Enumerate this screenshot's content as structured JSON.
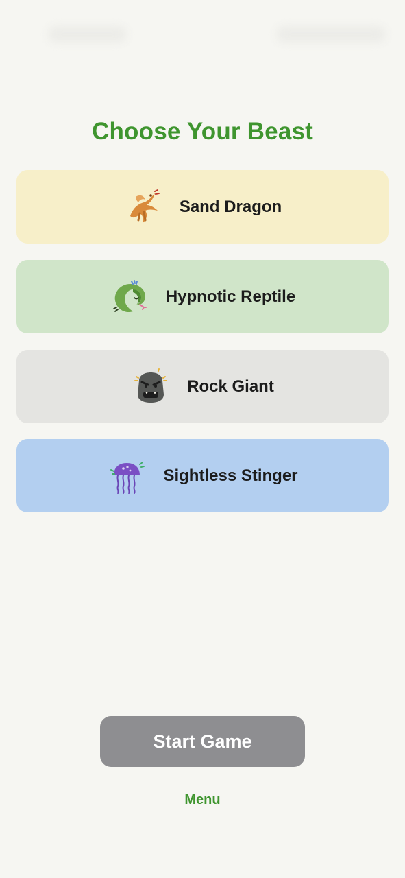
{
  "header": {
    "title": "Choose Your Beast"
  },
  "beasts": [
    {
      "label": "Sand Dragon",
      "icon": "sand-dragon-icon",
      "color": "#f7efc9"
    },
    {
      "label": "Hypnotic Reptile",
      "icon": "snake-icon",
      "color": "#d0e5c9"
    },
    {
      "label": "Rock Giant",
      "icon": "rock-giant-icon",
      "color": "#e4e4e1"
    },
    {
      "label": "Sightless Stinger",
      "icon": "jellyfish-icon",
      "color": "#b3cff0"
    }
  ],
  "actions": {
    "start_label": "Start Game",
    "menu_label": "Menu"
  },
  "colors": {
    "accent": "#3f952f",
    "background": "#f6f6f2",
    "button": "#8e8e91"
  }
}
